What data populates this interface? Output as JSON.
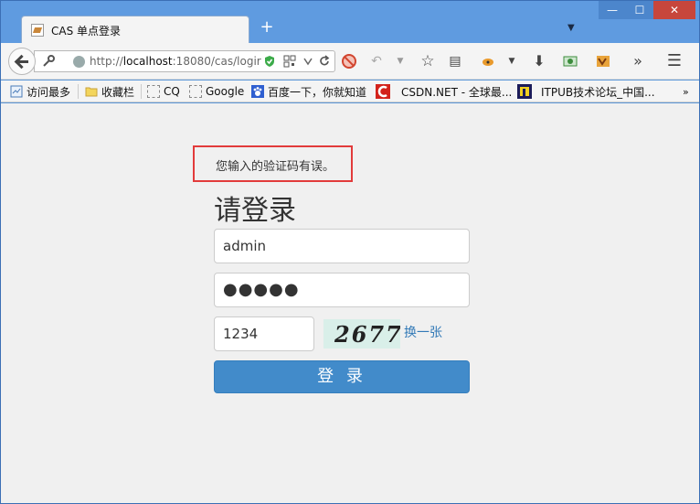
{
  "browser": {
    "tab_title": "CAS 单点登录",
    "new_tab_label": "+",
    "url_prefix": "http://",
    "url_host": "localhost",
    "url_rest": ":18080/cas/logir",
    "window_buttons": {
      "minimize": "—",
      "maximize": "☐",
      "close": "✕"
    },
    "overflow_chevron": "»"
  },
  "bookmarks": [
    {
      "label": "访问最多",
      "icon": "most-visited-icon"
    },
    {
      "label": "收藏栏",
      "icon": "folder-icon"
    },
    {
      "label": "CQ",
      "icon": "page-icon"
    },
    {
      "label": "Google",
      "icon": "page-icon"
    },
    {
      "label": "百度一下，你就知道",
      "icon": "baidu-paw-icon"
    },
    {
      "label": "CSDN.NET - 全球最...",
      "icon": "csdn-icon"
    },
    {
      "label": "ITPUB技术论坛_中国...",
      "icon": "itpub-icon"
    }
  ],
  "page": {
    "error_message": "您输入的验证码有误。",
    "heading": "请登录",
    "username_value": "admin",
    "password_value": "●●●●●",
    "captcha_value": "1234",
    "captcha_image_text": "2677",
    "refresh_captcha_label": "换一张",
    "login_button_label": "登 录"
  },
  "colors": {
    "title_bar": "#5f9be0",
    "error_border": "#e23b3b",
    "primary_button": "#428bca",
    "link": "#337ab7",
    "page_background": "#f0f0f0"
  }
}
